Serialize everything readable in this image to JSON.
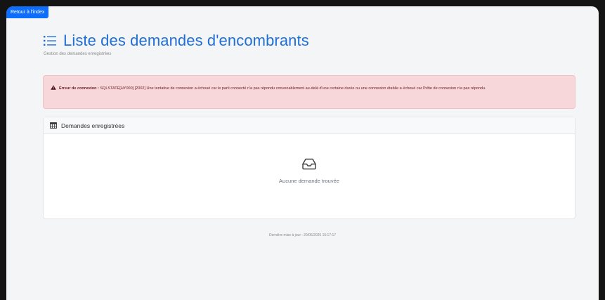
{
  "back_button": {
    "label": "Retour à l'index"
  },
  "header": {
    "title": "Liste des demandes d'encombrants",
    "subtitle": "Gestion des demandes enregistrées"
  },
  "alert": {
    "label": "Erreur de connexion :",
    "message": "SQLSTATE[HY000] [2002] Une tentative de connexion a échoué car le parti connecté n'a pas répondu convenablement au-delà d'une certaine durée ou une connexion établie a échoué car l'hôte de connexion n'a pas répondu."
  },
  "card": {
    "header": "Demandes enregistrées",
    "empty_text": "Aucune demande trouvée"
  },
  "footer": {
    "text": "Dernière mise à jour : 20/06/2025 15:17:17"
  },
  "colors": {
    "accent": "#0d6efd",
    "title": "#1f6fd6",
    "alert_bg": "#f7d7da",
    "alert_text": "#6b1c23"
  },
  "icons": {
    "title": "list-icon",
    "alert": "warning-triangle-icon",
    "card": "table-icon",
    "empty": "inbox-icon"
  }
}
